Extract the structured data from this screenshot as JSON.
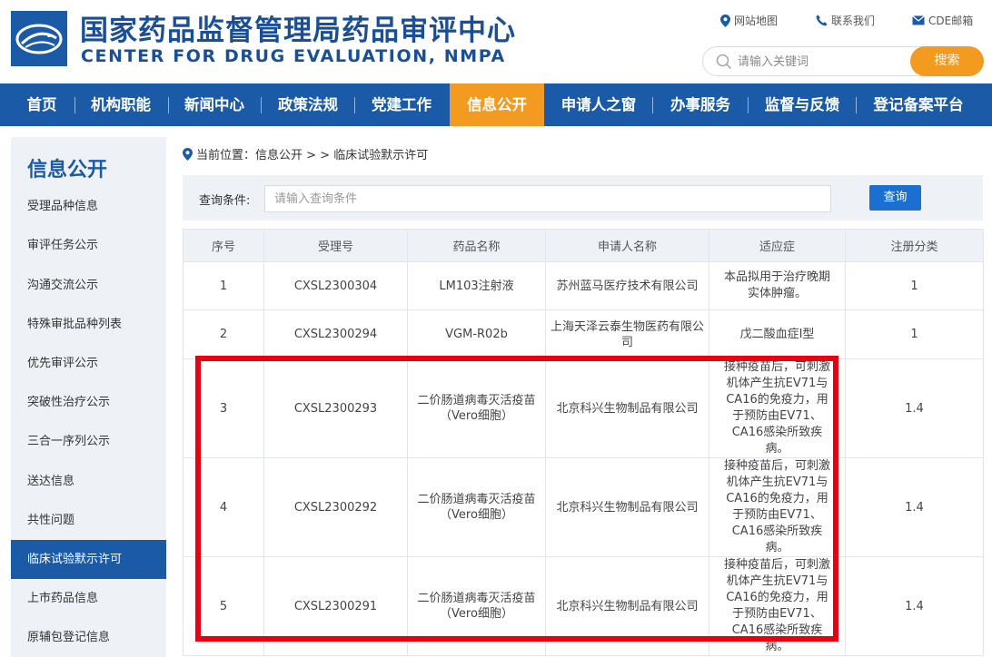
{
  "header": {
    "title_cn": "国家药品监督管理局药品审评中心",
    "title_en": "CENTER FOR DRUG EVALUATION, NMPA",
    "links": [
      "网站地图",
      "联系我们",
      "CDE邮箱"
    ],
    "search_placeholder": "请输入关键词",
    "search_button": "搜索"
  },
  "nav": {
    "items": [
      "首页",
      "机构职能",
      "新闻中心",
      "政策法规",
      "党建工作",
      "信息公开",
      "申请人之窗",
      "办事服务",
      "监督与反馈",
      "登记备案平台"
    ],
    "active": "信息公开"
  },
  "sidebar": {
    "title": "信息公开",
    "items": [
      "受理品种信息",
      "审评任务公示",
      "沟通交流公示",
      "特殊审批品种列表",
      "优先审评公示",
      "突破性治疗公示",
      "三合一序列公示",
      "送达信息",
      "共性问题",
      "临床试验默示许可",
      "上市药品信息",
      "原辅包登记信息"
    ],
    "active": "临床试验默示许可"
  },
  "breadcrumb": {
    "prefix": "当前位置：",
    "path": "信息公开 > > 临床试验默示许可"
  },
  "query": {
    "label": "查询条件:",
    "placeholder": "请输入查询条件",
    "button": "查询"
  },
  "table": {
    "headers": [
      "序号",
      "受理号",
      "药品名称",
      "申请人名称",
      "适应症",
      "注册分类"
    ],
    "rows": [
      [
        "1",
        "CXSL2300304",
        "LM103注射液",
        "苏州蓝马医疗技术有限公司",
        "本品拟用于治疗晚期实体肿瘤。",
        "1"
      ],
      [
        "2",
        "CXSL2300294",
        "VGM-R02b",
        "上海天泽云泰生物医药有限公司",
        "戊二酸血症I型",
        "1"
      ],
      [
        "3",
        "CXSL2300293",
        "二价肠道病毒灭活疫苗（Vero细胞）",
        "北京科兴生物制品有限公司",
        "接种疫苗后，可刺激机体产生抗EV71与CA16的免疫力，用于预防由EV71、CA16感染所致疾病。",
        "1.4"
      ],
      [
        "4",
        "CXSL2300292",
        "二价肠道病毒灭活疫苗（Vero细胞）",
        "北京科兴生物制品有限公司",
        "接种疫苗后，可刺激机体产生抗EV71与CA16的免疫力，用于预防由EV71、CA16感染所致疾病。",
        "1.4"
      ],
      [
        "5",
        "CXSL2300291",
        "二价肠道病毒灭活疫苗（Vero细胞）",
        "北京科兴生物制品有限公司",
        "接种疫苗后，可刺激机体产生抗EV71与CA16的免疫力，用于预防由EV71、CA16感染所致疾病。",
        "1.4"
      ]
    ]
  },
  "colors": {
    "brand_blue": "#1a5aa6",
    "accent_orange": "#f39a21",
    "highlight_red": "#e60012"
  }
}
